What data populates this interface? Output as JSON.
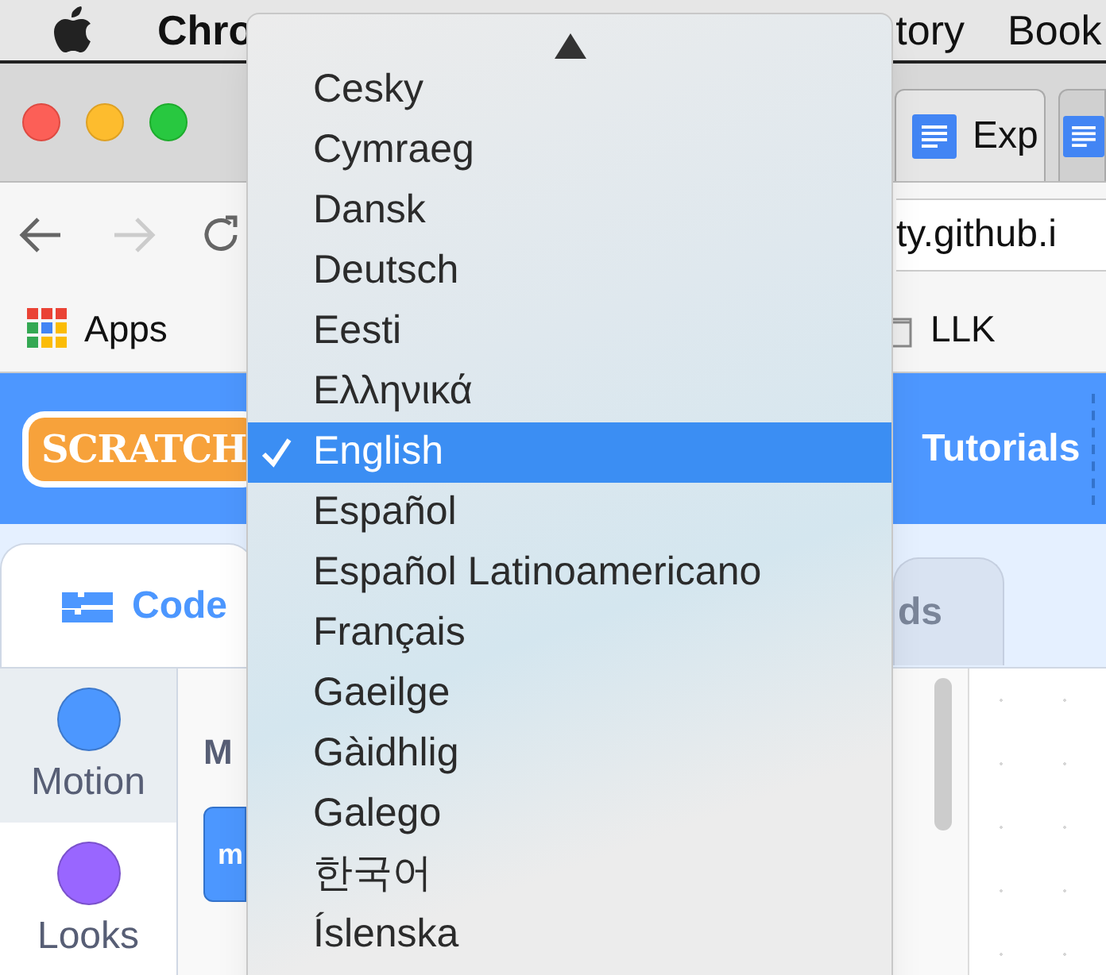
{
  "menu_bar": {
    "app": "Chro",
    "items": [
      "tory",
      "Book"
    ]
  },
  "browser": {
    "tabs": [
      {
        "title": "Exp"
      }
    ],
    "address": "ty.github.i",
    "bookmarks": [
      {
        "label": "Apps",
        "kind": "apps"
      },
      {
        "label": "LLK",
        "kind": "folder"
      }
    ]
  },
  "scratch": {
    "logo": "SCRATCH",
    "nav": [
      "Tutorials"
    ],
    "tabs": [
      {
        "label": "Code",
        "selected": true
      },
      {
        "label": "ds",
        "selected": false
      }
    ],
    "categories": [
      {
        "label": "Motion",
        "color": "#4c97ff",
        "selected": true
      },
      {
        "label": "Looks",
        "color": "#9966ff",
        "selected": false
      }
    ],
    "palette_heading": "M",
    "block": "m"
  },
  "language_menu": {
    "items": [
      {
        "label": "Cesky",
        "selected": false
      },
      {
        "label": "Cymraeg",
        "selected": false
      },
      {
        "label": "Dansk",
        "selected": false
      },
      {
        "label": "Deutsch",
        "selected": false
      },
      {
        "label": "Eesti",
        "selected": false
      },
      {
        "label": "Ελληνικά",
        "selected": false
      },
      {
        "label": "English",
        "selected": true
      },
      {
        "label": "Español",
        "selected": false
      },
      {
        "label": "Español Latinoamericano",
        "selected": false
      },
      {
        "label": "Français",
        "selected": false
      },
      {
        "label": "Gaeilge",
        "selected": false
      },
      {
        "label": "Gàidhlig",
        "selected": false
      },
      {
        "label": "Galego",
        "selected": false
      },
      {
        "label": "한국어",
        "selected": false
      },
      {
        "label": "Íslenska",
        "selected": false
      }
    ]
  }
}
